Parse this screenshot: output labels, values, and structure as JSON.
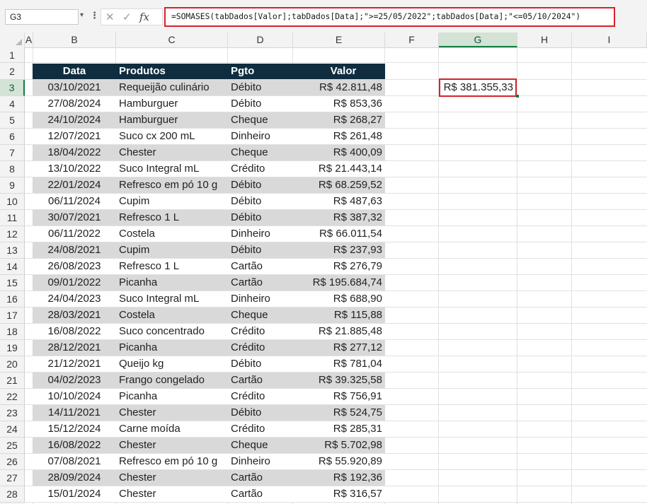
{
  "formula_bar": {
    "name_box": "G3",
    "fx_label": "fx",
    "formula": "=SOMASES(tabDados[Valor];tabDados[Data];\">=25/05/2022\";tabDados[Data];\"<=05/10/2024\")"
  },
  "columns": [
    "A",
    "B",
    "C",
    "D",
    "E",
    "F",
    "G",
    "H",
    "I"
  ],
  "selected_column": "G",
  "rows": [
    "1",
    "2",
    "3",
    "4",
    "5",
    "6",
    "7",
    "8",
    "9",
    "10",
    "11",
    "12",
    "13",
    "14",
    "15",
    "16",
    "17",
    "18",
    "19",
    "20",
    "21",
    "22",
    "23",
    "24",
    "25",
    "26",
    "27",
    "28"
  ],
  "selected_row": "3",
  "table": {
    "headers": [
      "Data",
      "Produtos",
      "Pgto",
      "Valor"
    ],
    "rows": [
      [
        "03/10/2021",
        "Requeijão culinário",
        "Débito",
        "R$ 42.811,48"
      ],
      [
        "27/08/2024",
        "Hamburguer",
        "Débito",
        "R$ 853,36"
      ],
      [
        "24/10/2024",
        "Hamburguer",
        "Cheque",
        "R$ 268,27"
      ],
      [
        "12/07/2021",
        "Suco cx 200 mL",
        "Dinheiro",
        "R$ 261,48"
      ],
      [
        "18/04/2022",
        "Chester",
        "Cheque",
        "R$ 400,09"
      ],
      [
        "13/10/2022",
        "Suco Integral mL",
        "Crédito",
        "R$ 21.443,14"
      ],
      [
        "22/01/2024",
        "Refresco em pó 10 g",
        "Débito",
        "R$ 68.259,52"
      ],
      [
        "06/11/2024",
        "Cupim",
        "Débito",
        "R$ 487,63"
      ],
      [
        "30/07/2021",
        "Refresco 1 L",
        "Débito",
        "R$ 387,32"
      ],
      [
        "06/11/2022",
        "Costela",
        "Dinheiro",
        "R$ 66.011,54"
      ],
      [
        "24/08/2021",
        "Cupim",
        "Débito",
        "R$ 237,93"
      ],
      [
        "26/08/2023",
        "Refresco 1 L",
        "Cartão",
        "R$ 276,79"
      ],
      [
        "09/01/2022",
        "Picanha",
        "Cartão",
        "R$ 195.684,74"
      ],
      [
        "24/04/2023",
        "Suco Integral mL",
        "Dinheiro",
        "R$ 688,90"
      ],
      [
        "28/03/2021",
        "Costela",
        "Cheque",
        "R$ 115,88"
      ],
      [
        "16/08/2022",
        "Suco concentrado",
        "Crédito",
        "R$ 21.885,48"
      ],
      [
        "28/12/2021",
        "Picanha",
        "Crédito",
        "R$ 277,12"
      ],
      [
        "21/12/2021",
        "Queijo kg",
        "Débito",
        "R$ 781,04"
      ],
      [
        "04/02/2023",
        "Frango congelado",
        "Cartão",
        "R$ 39.325,58"
      ],
      [
        "10/10/2024",
        "Picanha",
        "Crédito",
        "R$ 756,91"
      ],
      [
        "14/11/2021",
        "Chester",
        "Débito",
        "R$ 524,75"
      ],
      [
        "15/12/2024",
        "Carne moída",
        "Crédito",
        "R$ 285,31"
      ],
      [
        "16/08/2022",
        "Chester",
        "Cheque",
        "R$ 5.702,98"
      ],
      [
        "07/08/2021",
        "Refresco em pó 10 g",
        "Dinheiro",
        "R$ 55.920,89"
      ],
      [
        "28/09/2024",
        "Chester",
        "Cartão",
        "R$ 192,36"
      ],
      [
        "15/01/2024",
        "Chester",
        "Cartão",
        "R$ 316,57"
      ]
    ]
  },
  "result": {
    "cell": "G3",
    "value": "R$ 381.355,33"
  },
  "colors": {
    "header_fill": "#0f2d3f",
    "band_fill": "#d9d9d9",
    "highlight_border": "#d7222a",
    "selection_accent": "#107c41"
  }
}
